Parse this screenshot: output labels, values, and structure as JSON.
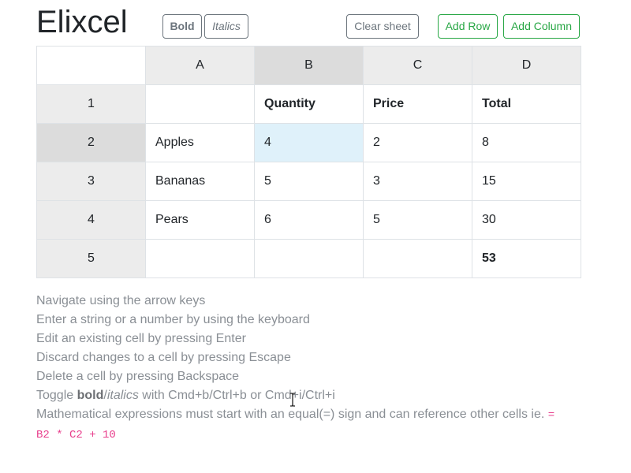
{
  "app": {
    "title": "Elixcel"
  },
  "toolbar": {
    "bold_label": "Bold",
    "italics_label": "Italics",
    "clear_label": "Clear sheet",
    "add_row_label": "Add Row",
    "add_column_label": "Add Column"
  },
  "sheet": {
    "columns": [
      "A",
      "B",
      "C",
      "D"
    ],
    "active_column": "B",
    "active_row": "2",
    "selected_cell": "B2",
    "rows": [
      {
        "label": "1",
        "cells": [
          "",
          "Quantity",
          "Price",
          "Total"
        ]
      },
      {
        "label": "2",
        "cells": [
          "Apples",
          "4",
          "2",
          "8"
        ]
      },
      {
        "label": "3",
        "cells": [
          "Bananas",
          "5",
          "3",
          "15"
        ]
      },
      {
        "label": "4",
        "cells": [
          "Pears",
          "6",
          "5",
          "30"
        ]
      },
      {
        "label": "5",
        "cells": [
          "",
          "",
          "",
          "53"
        ]
      }
    ]
  },
  "instructions": {
    "line1": "Navigate using the arrow keys",
    "line2": "Enter a string or a number by using the keyboard",
    "line3": "Edit an existing cell by pressing Enter",
    "line4": "Discard changes to a cell by pressing Escape",
    "line5": "Delete a cell by pressing Backspace",
    "line6_prefix": "Toggle ",
    "line6_bold": "bold",
    "line6_sep": "/",
    "line6_italics": "italics",
    "line6_suffix": " with Cmd+b/Ctrl+b or Cmd+i/Ctrl+i",
    "line7_text": "Mathematical expressions must start with an equal(=) sign and can reference other cells ie. ",
    "line7_code_a": "=",
    "line7_code_b": "B2 * C2 + 10"
  },
  "colors": {
    "selected_cell": "#dff1fa",
    "header_bg": "#ececec",
    "header_active_bg": "#dcdcdc",
    "success": "#28a745",
    "secondary": "#6c757d",
    "code": "#e83e8c"
  },
  "icons": {
    "cursor": "text-cursor-icon"
  }
}
